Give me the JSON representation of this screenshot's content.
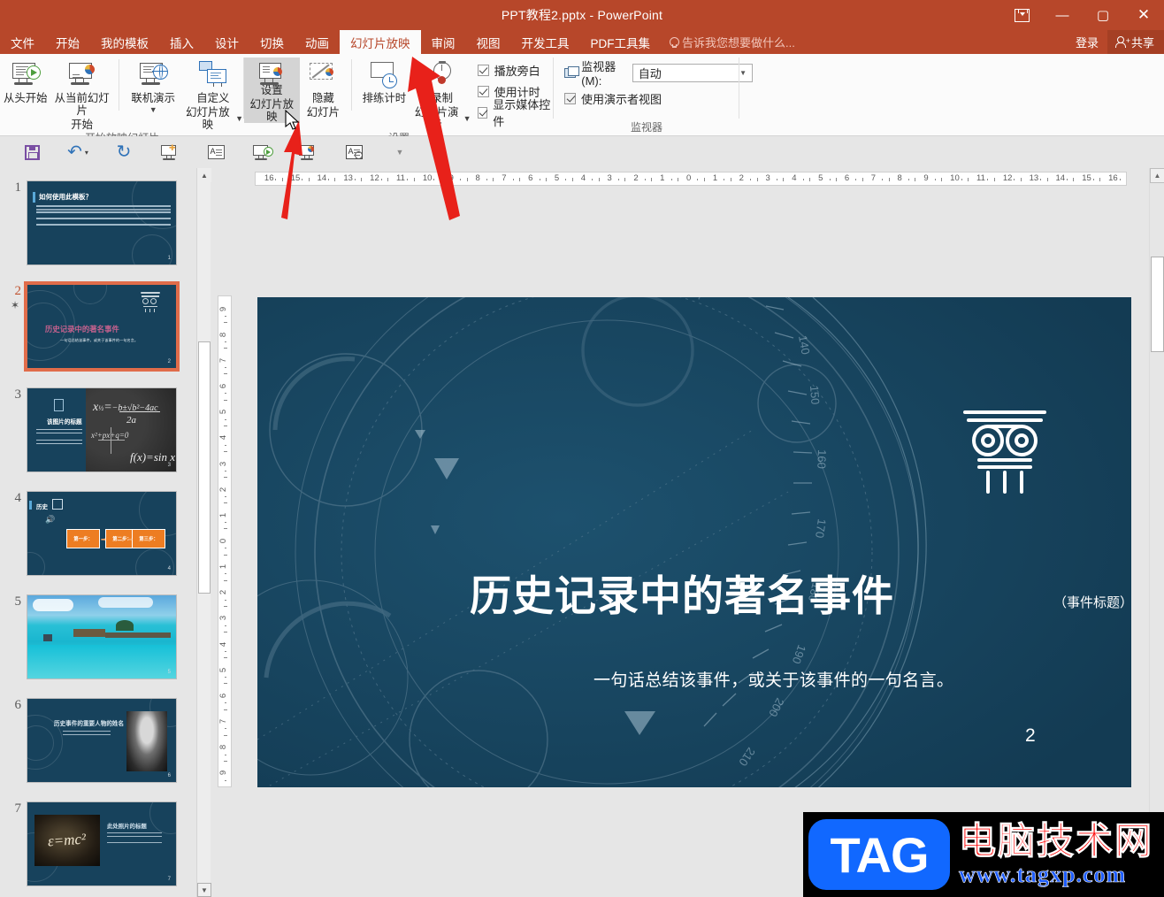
{
  "window": {
    "title": "PPT教程2.pptx - PowerPoint",
    "ribbon_display_label": "功能区显示选项",
    "minimize_label": "—",
    "maximize_label": "▢",
    "close_label": "✕"
  },
  "tabs": [
    {
      "label": "文件",
      "active": false
    },
    {
      "label": "开始",
      "active": false
    },
    {
      "label": "我的模板",
      "active": false
    },
    {
      "label": "插入",
      "active": false
    },
    {
      "label": "设计",
      "active": false
    },
    {
      "label": "切换",
      "active": false
    },
    {
      "label": "动画",
      "active": false
    },
    {
      "label": "幻灯片放映",
      "active": true
    },
    {
      "label": "审阅",
      "active": false
    },
    {
      "label": "视图",
      "active": false
    },
    {
      "label": "开发工具",
      "active": false
    },
    {
      "label": "PDF工具集",
      "active": false
    }
  ],
  "tellme": {
    "placeholder": "告诉我您想要做什么..."
  },
  "account": {
    "signin_label": "登录",
    "share_label": "共享"
  },
  "ribbon": {
    "groups": [
      {
        "name": "开始放映幻灯片",
        "buttons": [
          {
            "label_line1": "从头开始",
            "label_line2": ""
          },
          {
            "label_line1": "从当前幻灯片",
            "label_line2": "开始"
          },
          {
            "label_line1": "联机演示",
            "label_line2": "",
            "has_caret": true
          },
          {
            "label_line1": "自定义",
            "label_line2": "幻灯片放映",
            "has_caret": true
          }
        ]
      },
      {
        "name": "设置",
        "buttons": [
          {
            "label_line1": "设置",
            "label_line2": "幻灯片放映",
            "selected": true
          },
          {
            "label_line1": "隐藏",
            "label_line2": "幻灯片"
          },
          {
            "label_line1": "排练计时",
            "label_line2": ""
          },
          {
            "label_line1": "录制",
            "label_line2": "幻灯片演示",
            "has_caret": true
          }
        ],
        "checkboxes": [
          {
            "label": "播放旁白",
            "checked": true
          },
          {
            "label": "使用计时",
            "checked": true
          },
          {
            "label": "显示媒体控件",
            "checked": true
          }
        ]
      },
      {
        "name": "监视器",
        "monitor_label": "监视器(M):",
        "monitor_value": "自动",
        "presenter_checkbox": {
          "label": "使用演示者视图",
          "checked": true
        }
      }
    ]
  },
  "quick_access": [
    {
      "icon": "save-icon",
      "label": "保存"
    },
    {
      "icon": "undo-icon",
      "label": "撤消",
      "has_caret": true
    },
    {
      "icon": "redo-icon",
      "label": "恢复"
    },
    {
      "icon": "new-slide-icon",
      "label": "新建幻灯片"
    },
    {
      "icon": "text-box-icon",
      "label": "文本框"
    },
    {
      "icon": "start-show-icon",
      "label": "从头开始放映"
    },
    {
      "icon": "current-slide-show-icon",
      "label": "从当前幻灯片开始"
    },
    {
      "icon": "print-preview-icon",
      "label": "打印预览"
    },
    {
      "icon": "more-caret-icon",
      "label": "自定义快速访问工具栏"
    }
  ],
  "thumbnails": [
    {
      "number": "1",
      "selected": false,
      "starred": false,
      "kind": "bullets",
      "title": "如何使用此模板？",
      "page_label": "1"
    },
    {
      "number": "2",
      "selected": true,
      "starred": true,
      "kind": "title-column",
      "title": "历史记录中的著名事件",
      "subtitle": "一句话总结该事件，或关于该事件的一句名言。",
      "page_label": "2"
    },
    {
      "number": "3",
      "selected": false,
      "starred": false,
      "kind": "chalkboard",
      "title": "该图片的标题",
      "page_label": "3"
    },
    {
      "number": "4",
      "selected": false,
      "starred": false,
      "kind": "steps",
      "title": "历史",
      "steps": [
        "第一步：",
        "第二步：",
        "第三步："
      ],
      "page_label": "4"
    },
    {
      "number": "5",
      "selected": false,
      "starred": false,
      "kind": "photo-beach",
      "page_label": "5"
    },
    {
      "number": "6",
      "selected": false,
      "starred": false,
      "kind": "portrait",
      "title": "历史事件的重要人物的姓名",
      "page_label": "6"
    },
    {
      "number": "7",
      "selected": false,
      "starred": false,
      "kind": "emc2",
      "title": "此处照片的标题",
      "page_label": "7"
    }
  ],
  "ruler": {
    "horizontal": [
      "16",
      "15",
      "14",
      "13",
      "12",
      "11",
      "10",
      "9",
      "8",
      "7",
      "6",
      "5",
      "4",
      "3",
      "2",
      "1",
      "0",
      "1",
      "2",
      "3",
      "4",
      "5",
      "6",
      "7",
      "8",
      "9",
      "10",
      "11",
      "12",
      "13",
      "14",
      "15",
      "16"
    ],
    "vertical": [
      "9",
      "8",
      "7",
      "6",
      "5",
      "4",
      "3",
      "2",
      "1",
      "0",
      "1",
      "2",
      "3",
      "4",
      "5",
      "6",
      "7",
      "8",
      "9"
    ]
  },
  "slide": {
    "title": "历史记录中的著名事件",
    "title_suffix": "（事件标题）",
    "subtitle": "一句话总结该事件，或关于该事件的一句名言。",
    "page_number": "2",
    "background_color": "#17425c",
    "icon_name": "ionic-column-icon"
  },
  "watermark": {
    "badge": "TAG",
    "site_name": "电脑技术网",
    "url": "www.tagxp.com"
  },
  "colors": {
    "ribbon_accent": "#b7472a",
    "slide_bg": "#17425c",
    "selection": "#e06c4a",
    "annotation_arrow": "#e8211a"
  }
}
